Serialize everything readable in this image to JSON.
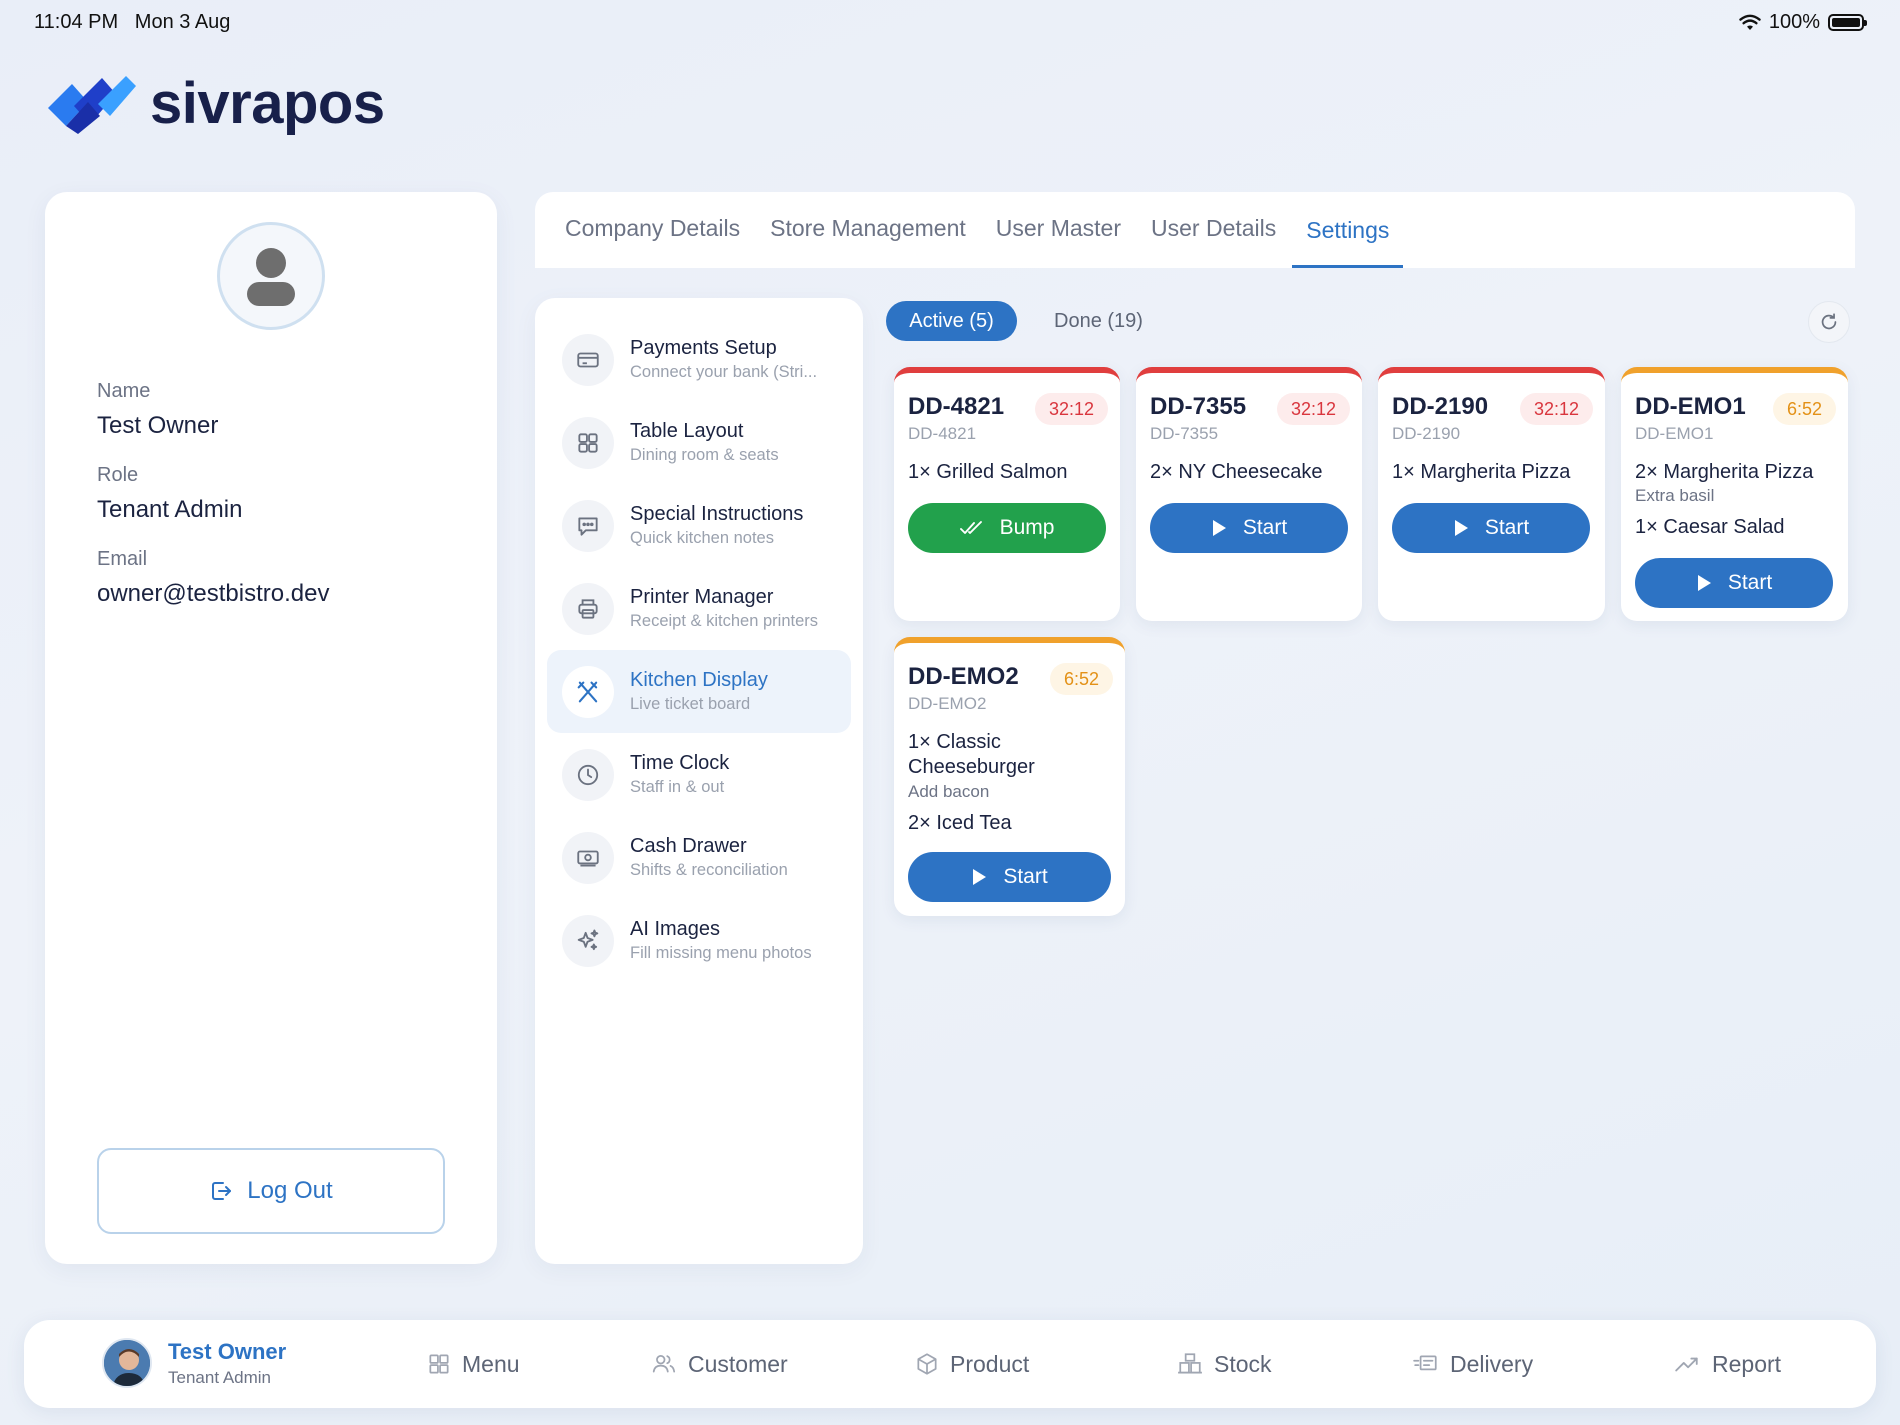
{
  "status_bar": {
    "time": "11:04 PM",
    "date": "Mon 3 Aug",
    "battery": "100%"
  },
  "brand": {
    "name": "sivrapos"
  },
  "profile": {
    "name_label": "Name",
    "name": "Test Owner",
    "role_label": "Role",
    "role": "Tenant Admin",
    "email_label": "Email",
    "email": "owner@testbistro.dev",
    "logout_label": "Log Out"
  },
  "tabs": [
    {
      "label": "Company Details"
    },
    {
      "label": "Store Management"
    },
    {
      "label": "User Master"
    },
    {
      "label": "User Details"
    },
    {
      "label": "Settings",
      "active": true
    }
  ],
  "settings_menu": [
    {
      "title": "Payments Setup",
      "subtitle": "Connect your bank (Stri...",
      "icon": "card-icon"
    },
    {
      "title": "Table Layout",
      "subtitle": "Dining room & seats",
      "icon": "grid-icon"
    },
    {
      "title": "Special Instructions",
      "subtitle": "Quick kitchen notes",
      "icon": "chat-icon"
    },
    {
      "title": "Printer Manager",
      "subtitle": "Receipt & kitchen printers",
      "icon": "printer-icon"
    },
    {
      "title": "Kitchen Display",
      "subtitle": "Live ticket board",
      "icon": "utensils-icon",
      "active": true
    },
    {
      "title": "Time Clock",
      "subtitle": "Staff in & out",
      "icon": "clock-icon"
    },
    {
      "title": "Cash Drawer",
      "subtitle": "Shifts & reconciliation",
      "icon": "cash-icon"
    },
    {
      "title": "AI Images",
      "subtitle": "Fill missing menu photos",
      "icon": "sparkle-icon"
    }
  ],
  "kitchen": {
    "active_filter": "Active (5)",
    "done_filter": "Done (19)",
    "tickets": [
      {
        "id": "DD-4821",
        "sub": "DD-4821",
        "timer": "32:12",
        "status": "late",
        "items": [
          {
            "text": "1× Grilled Salmon"
          }
        ],
        "action": "Bump"
      },
      {
        "id": "DD-7355",
        "sub": "DD-7355",
        "timer": "32:12",
        "status": "late",
        "items": [
          {
            "text": "2× NY Cheesecake"
          }
        ],
        "action": "Start"
      },
      {
        "id": "DD-2190",
        "sub": "DD-2190",
        "timer": "32:12",
        "status": "late",
        "items": [
          {
            "text": "1× Margherita Pizza"
          }
        ],
        "action": "Start"
      },
      {
        "id": "DD-EMO1",
        "sub": "DD-EMO1",
        "timer": "6:52",
        "status": "warning",
        "items": [
          {
            "text": "2× Margherita Pizza",
            "note": "Extra basil"
          },
          {
            "text": "1× Caesar Salad"
          }
        ],
        "action": "Start"
      },
      {
        "id": "DD-EMO2",
        "sub": "DD-EMO2",
        "timer": "6:52",
        "status": "warning",
        "items": [
          {
            "text": "1× Classic Cheeseburger",
            "note": "Add bacon"
          },
          {
            "text": "2× Iced Tea"
          }
        ],
        "action": "Start"
      }
    ]
  },
  "bottom_nav": {
    "user_name": "Test Owner",
    "user_role": "Tenant Admin",
    "items": [
      {
        "label": "Menu",
        "icon": "menu-grid-icon"
      },
      {
        "label": "Customer",
        "icon": "users-icon"
      },
      {
        "label": "Product",
        "icon": "box-icon"
      },
      {
        "label": "Stock",
        "icon": "warehouse-icon"
      },
      {
        "label": "Delivery",
        "icon": "delivery-icon"
      },
      {
        "label": "Report",
        "icon": "trend-icon"
      }
    ]
  },
  "colors": {
    "accent": "#2d73c4",
    "success": "#22a14c",
    "danger": "#d9363e",
    "warning": "#e39117"
  }
}
